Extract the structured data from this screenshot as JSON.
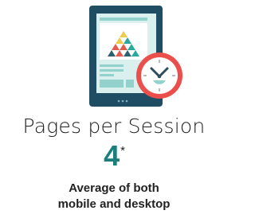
{
  "colors": {
    "text": "#222222",
    "accent": "#1a7e7a",
    "tablet_frame": "#1f4d63",
    "screen": "#d9f0ee",
    "screen_blocks": "#93d2cc",
    "clock_ring": "#ea4f4b",
    "clock_face": "#ffffff",
    "clock_hands": "#2d4e5c",
    "clock_ticks": "#9aa6ad",
    "pyramid": [
      "#f0c94d",
      "#e35b4c",
      "#27a9a0",
      "#2c5f73"
    ]
  },
  "icons": {
    "tablet": "tablet-icon",
    "clock": "clock-icon",
    "pyramid": "pyramid-graphic"
  },
  "metric": {
    "title": "Pages per Session",
    "value": "4",
    "footnote_mark": "*"
  },
  "caption": {
    "line1": "Average of both",
    "line2": "mobile and desktop"
  }
}
